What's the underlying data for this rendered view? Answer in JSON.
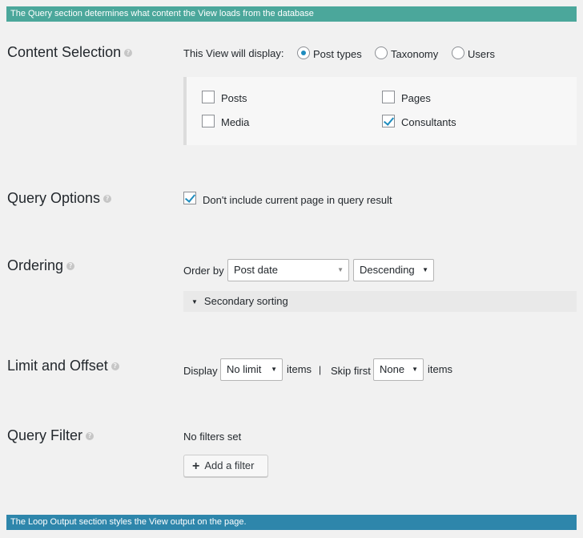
{
  "banners": {
    "query": "The Query section determines what content the View loads from the database",
    "loop": "The Loop Output section styles the View output on the page."
  },
  "content_selection": {
    "title": "Content Selection",
    "display_label": "This View will display:",
    "options": [
      "Post types",
      "Taxonomy",
      "Users"
    ],
    "selected": "Post types",
    "post_types": [
      {
        "label": "Posts",
        "checked": false
      },
      {
        "label": "Pages",
        "checked": false
      },
      {
        "label": "Media",
        "checked": false
      },
      {
        "label": "Consultants",
        "checked": true
      }
    ]
  },
  "query_options": {
    "title": "Query Options",
    "exclude_current_label": "Don't include current page in query result",
    "exclude_current_checked": true
  },
  "ordering": {
    "title": "Ordering",
    "order_by_label": "Order by",
    "order_by_value": "Post date",
    "direction_value": "Descending",
    "secondary_label": "Secondary sorting"
  },
  "limit_offset": {
    "title": "Limit and Offset",
    "display_label": "Display",
    "limit_value": "No limit",
    "items_label": "items",
    "separator": "|",
    "skip_label": "Skip first",
    "skip_value": "None",
    "items_label_2": "items"
  },
  "query_filter": {
    "title": "Query Filter",
    "status": "No filters set",
    "add_button": "Add a filter"
  },
  "help_glyph": "?",
  "colors": {
    "query_banner": "#4ba79b",
    "loop_banner": "#2e86ab",
    "accent": "#1e8cbe",
    "background": "#f1f1f1"
  }
}
